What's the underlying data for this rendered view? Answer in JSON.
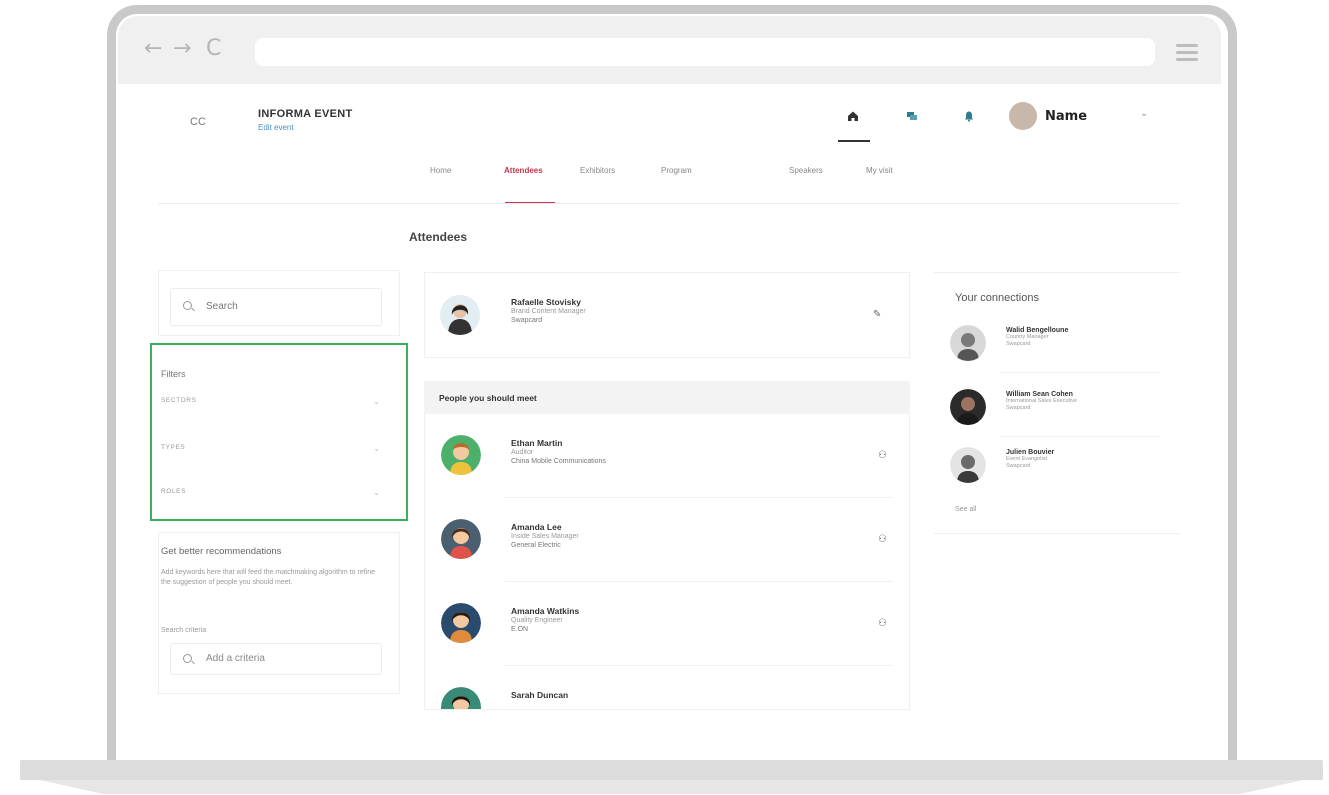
{
  "browser": {
    "back_icon": "back-arrow-icon",
    "forward_icon": "forward-arrow-icon",
    "reload_icon": "reload-icon",
    "back_glyph": "←",
    "forward_glyph": "→",
    "reload_glyph": "C",
    "url": ""
  },
  "header": {
    "logo": "CC",
    "event_title": "INFORMA EVENT",
    "edit_event": "Edit event",
    "user_name": "Name",
    "icons": [
      "home-icon",
      "chat-icon",
      "bell-icon"
    ]
  },
  "tabs": [
    {
      "label": "Home",
      "active": false
    },
    {
      "label": "Attendees",
      "active": true
    },
    {
      "label": "Exhibitors",
      "active": false
    },
    {
      "label": "Program",
      "active": false
    },
    {
      "label": "Speakers",
      "active": false
    },
    {
      "label": "My visit",
      "active": false
    }
  ],
  "page_title": "Attendees",
  "sidebar": {
    "search_placeholder": "Search",
    "filters_title": "Filters",
    "filters": [
      "SECTORS",
      "TYPES",
      "ROLES"
    ],
    "rec_title": "Get better recommendations",
    "rec_desc": "Add keywords here that will feed the matchmaking algorithm to refine the suggestion of people you should meet.",
    "rec_label": "Search criteria",
    "criteria_placeholder": "Add a criteria"
  },
  "profile": {
    "name": "Rafaelle Stovisky",
    "title": "Brand Content Manager",
    "company": "Swapcard"
  },
  "meet": {
    "header": "People you should meet",
    "people": [
      {
        "name": "Ethan Martin",
        "title": "Auditor",
        "company": "China Mobile Communications"
      },
      {
        "name": "Amanda Lee",
        "title": "Inside Sales Manager",
        "company": "General Electric"
      },
      {
        "name": "Amanda Watkins",
        "title": "Quality Engineer",
        "company": "E.ON"
      },
      {
        "name": "Sarah Duncan",
        "title": "",
        "company": ""
      }
    ]
  },
  "connections": {
    "title": "Your connections",
    "people": [
      {
        "name": "Walid Bengelloune",
        "title": "Country Manager",
        "company": "Swapcard"
      },
      {
        "name": "William Sean Cohen",
        "title": "International Sales Executive",
        "company": "Swapcard"
      },
      {
        "name": "Julien Bouvier",
        "title": "Event Evangelist",
        "company": "Swapcard"
      }
    ],
    "see_all": "See all"
  },
  "colors": {
    "accent": "#c7334a",
    "highlight": "#3fae5c"
  }
}
